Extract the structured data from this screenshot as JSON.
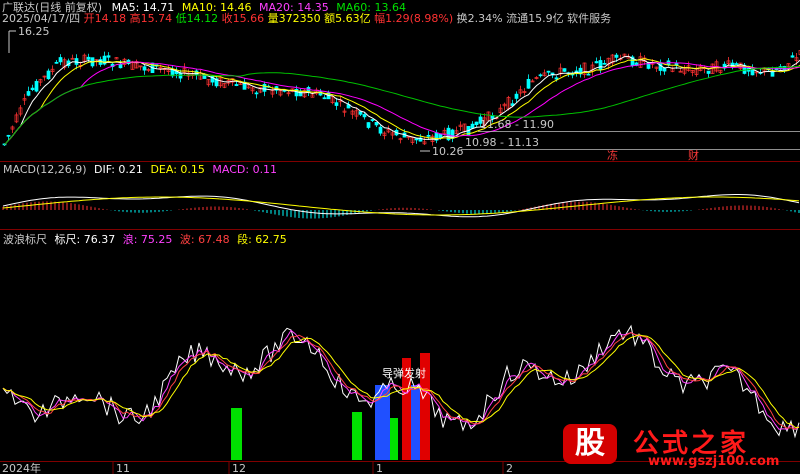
{
  "header": {
    "title": "广联达(日线 前复权)",
    "ma5": "MA5: 14.71",
    "ma10": "MA10: 14.46",
    "ma20": "MA20: 14.35",
    "ma60": "MA60: 13.64",
    "date": "2025/04/17/四",
    "open": "开14.18",
    "high": "高15.74",
    "low": "低14.12",
    "close": "收15.66",
    "volume": "量372350",
    "amount": "额5.63亿",
    "change": "幅1.29(8.98%)",
    "turnover": "换2.34%",
    "float_cap": "流通15.9亿",
    "industry": "软件服务"
  },
  "price_annotations": {
    "high_mark": "16.25",
    "low_mark": "10.26",
    "range1": "11.68 - 11.90",
    "range2": "10.98 - 11.13",
    "event1": "冻",
    "event2": "财"
  },
  "macd": {
    "name": "MACD(12,26,9)",
    "dif": "DIF: 0.21",
    "dea": "DEA: 0.15",
    "macd": "MACD: 0.11"
  },
  "wave": {
    "name": "波浪标尺",
    "ruler": "标尺: 76.37",
    "wave": "浪: 75.25",
    "bo": "波: 67.48",
    "duan": "段: 62.75",
    "signal": "导弹发射"
  },
  "time_axis": [
    "2024年",
    "11",
    "12",
    "1",
    "2"
  ],
  "watermark": {
    "logo": "股",
    "name": "公式之家",
    "url": "www.gszj100.com"
  },
  "colors": {
    "up": "#ff3232",
    "down": "#00ffff",
    "ma5": "#ffffff",
    "ma10": "#ffff00",
    "ma20": "#ff00ff",
    "ma60": "#00c000",
    "wave_green": "#00e000",
    "wave_blue": "#2050ff",
    "wave_red": "#e00000"
  }
}
